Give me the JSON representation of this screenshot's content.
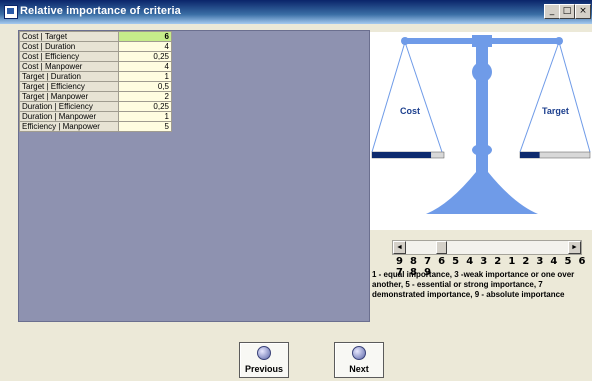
{
  "window": {
    "title": "Relative importance of criteria",
    "min_label": "_",
    "max_label": "□",
    "close_label": "×"
  },
  "criteria_grid": [
    {
      "label": "Cost | Target",
      "value": "6",
      "selected": true
    },
    {
      "label": "Cost | Duration",
      "value": "4"
    },
    {
      "label": "Cost | Efficiency",
      "value": "0,25"
    },
    {
      "label": "Cost | Manpower",
      "value": "4"
    },
    {
      "label": "Target | Duration",
      "value": "1"
    },
    {
      "label": "Target | Efficiency",
      "value": "0,5"
    },
    {
      "label": "Target | Manpower",
      "value": "2"
    },
    {
      "label": "Duration | Efficiency",
      "value": "0,25"
    },
    {
      "label": "Duration | Manpower",
      "value": "1"
    },
    {
      "label": "Efficiency | Manpower",
      "value": "5"
    }
  ],
  "balance": {
    "left_label": "Cost",
    "right_label": "Target",
    "left_level": 0.82,
    "right_level": 0.28,
    "color": "#6f9be8"
  },
  "slider": {
    "numbers": "9 8 7 6 5 4 3 2 1 2 3 4 5 6 7 8 9",
    "left_arrow": "◄",
    "right_arrow": "►",
    "position": 0.2
  },
  "legend": "1 - equal importance, 3 -weak importance or one over another, 5 - essential or strong importance, 7 demonstrated importance, 9 - absolute importance",
  "buttons": {
    "previous": "Previous",
    "next": "Next"
  }
}
